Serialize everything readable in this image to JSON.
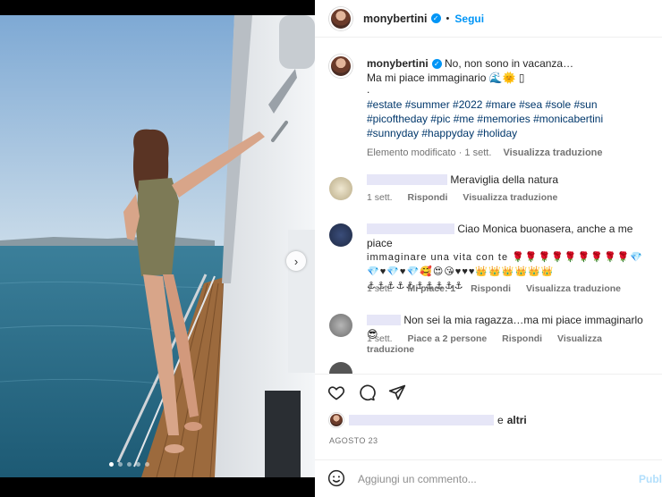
{
  "post": {
    "username": "monybertini",
    "follow_label": "Segui",
    "dot": "•",
    "verified_mark": "✓",
    "next_arrow": "›",
    "carousel_dots": 5,
    "carousel_active": 1
  },
  "caption": {
    "username": "monybertini",
    "line1": "No, non sono in vacanza…",
    "line2": "Ma mi piace immaginario 🌊🌞 ▯",
    "line3": ".",
    "hashtags": "#estate #summer #2022 #mare #sea #sole #sun #picoftheday #pic #me #memories #monicabertini #sunnyday #happyday #holiday",
    "edited": "Elemento modificato · 1 sett.",
    "translate": "Visualizza traduzione"
  },
  "comments": [
    {
      "text": "Meraviglia della natura",
      "time": "1 sett.",
      "reply": "Rispondi",
      "translate": "Visualizza traduzione"
    },
    {
      "text_line1": "Ciao Monica buonasera, anche a me piace",
      "text_line2": "immaginare una vita con te 🌹🌹🌹🌹🌹🌹🌹🌹🌹💎",
      "text_line3": "💎♥💎♥💎🥰😍😘♥♥♥👑👑👑👑👑👑",
      "text_line4": "⚓⚓⚓⚓⚓⚓⚓⚓⚓⚓",
      "time": "1 sett.",
      "likes": "Mi piace: 1",
      "reply": "Rispondi",
      "translate": "Visualizza traduzione"
    },
    {
      "text": "Non sei la mia ragazza…ma mi piace immaginarlo 😎",
      "time": "1 sett.",
      "likes": "Piace a 2 persone",
      "reply": "Rispondi",
      "translate": "Visualizza traduzione"
    }
  ],
  "likes_summary": {
    "suffix": "e",
    "others": "altri"
  },
  "date": "AGOSTO 23",
  "add_comment": {
    "placeholder": "Aggiungi un commento...",
    "publish": "Publ"
  },
  "icons": {
    "like": "heart-icon",
    "comment": "comment-icon",
    "share": "share-icon",
    "emoji": "emoji-icon"
  }
}
